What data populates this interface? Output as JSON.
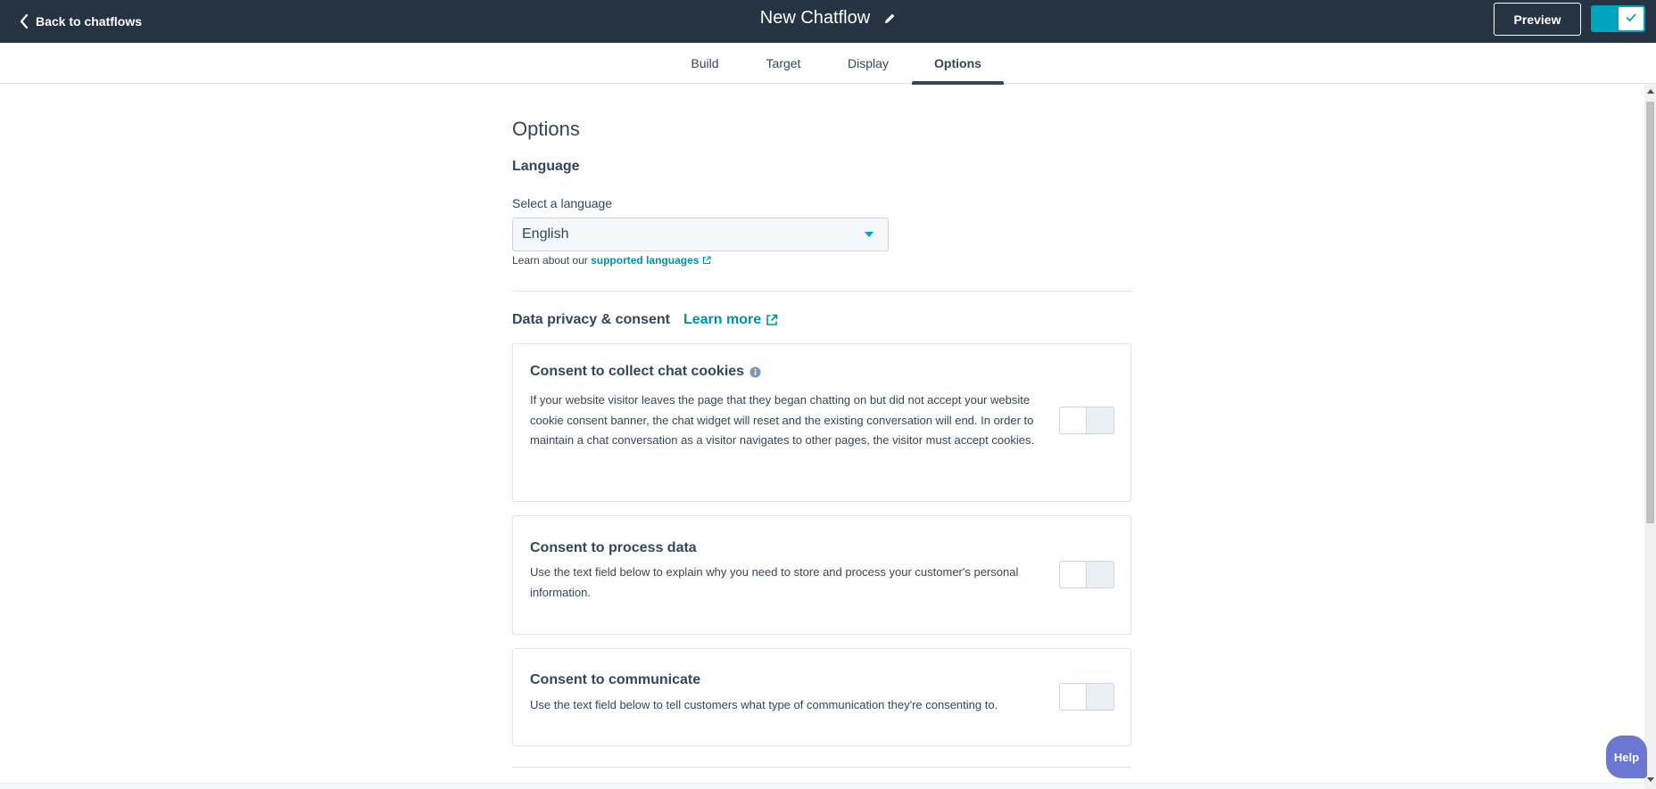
{
  "header": {
    "back_label": "Back to chatflows",
    "title": "New Chatflow",
    "preview_label": "Preview",
    "colors": {
      "bar": "#253342",
      "accent": "#00a4bd"
    }
  },
  "tabs": [
    {
      "label": "Build",
      "active": false
    },
    {
      "label": "Target",
      "active": false
    },
    {
      "label": "Display",
      "active": false
    },
    {
      "label": "Options",
      "active": true
    }
  ],
  "options": {
    "title": "Options",
    "language": {
      "section_label": "Language",
      "field_label": "Select a language",
      "selected": "English",
      "help_prefix": "Learn about our",
      "help_link": "supported languages"
    },
    "privacy": {
      "title": "Data privacy & consent",
      "learn_more": "Learn more",
      "cards": [
        {
          "title": "Consent to collect chat cookies",
          "has_info_icon": true,
          "body": "If your website visitor leaves the page that they began chatting on but did not accept your website cookie consent banner, the chat widget will reset and the existing conversation will end. In order to maintain a chat conversation as a visitor navigates to other pages, the visitor must accept cookies.",
          "enabled": false
        },
        {
          "title": "Consent to process data",
          "body": "Use the text field below to explain why you need to store and process your customer's personal information.",
          "enabled": false
        },
        {
          "title": "Consent to communicate",
          "body": "Use the text field below to tell customers what type of communication they're consenting to.",
          "enabled": false
        }
      ]
    }
  },
  "help_button": "Help"
}
